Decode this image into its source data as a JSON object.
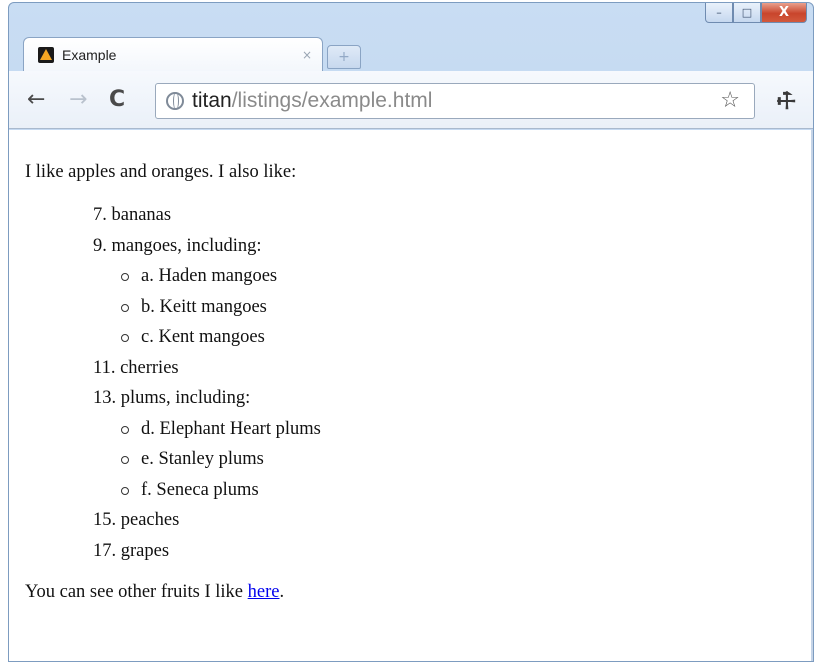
{
  "window": {
    "controls": {
      "minimize": "–",
      "maximize": "□",
      "close": "X"
    }
  },
  "tab": {
    "title": "Example",
    "close": "×",
    "favicon_icon": "warning-triangle-favicon"
  },
  "new_tab": {
    "label": "+"
  },
  "toolbar": {
    "back": "←",
    "forward": "→",
    "reload": "C",
    "url_host": "titan",
    "url_path": "/listings/example.html",
    "star": "☆",
    "wrench": "⚒"
  },
  "content": {
    "intro": "I like apples and oranges. I also like:",
    "items": [
      {
        "label": "7. bananas"
      },
      {
        "label": "9. mangoes, including:",
        "sub": [
          "a. Haden mangoes",
          "b. Keitt mangoes",
          "c. Kent mangoes"
        ]
      },
      {
        "label": "11. cherries"
      },
      {
        "label": "13. plums, including:",
        "sub": [
          "d. Elephant Heart plums",
          "e. Stanley plums",
          "f. Seneca plums"
        ]
      },
      {
        "label": "15. peaches"
      },
      {
        "label": "17. grapes"
      }
    ],
    "outro_prefix": "You can see other fruits I like ",
    "outro_link": "here",
    "outro_suffix": "."
  },
  "colors": {
    "link": "#0000ee",
    "close_button": "#c9452c",
    "frame": "#b9d1ee"
  }
}
